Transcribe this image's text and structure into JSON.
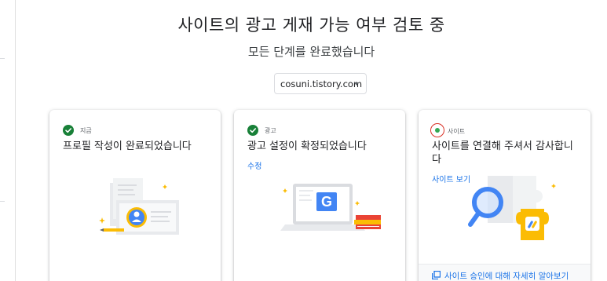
{
  "header": {
    "title": "사이트의 광고 게재 가능 여부 검토 중",
    "subtitle": "모든 단계를 완료했습니다"
  },
  "site_selector": {
    "value": "cosuni.tistory.com"
  },
  "cards": [
    {
      "step_label": "지금",
      "status": "complete",
      "heading": "프로필 작성이 완료되었습니다",
      "icon": "profile-card-illustration"
    },
    {
      "step_label": "광고",
      "status": "complete",
      "heading": "광고 설정이 확정되었습니다",
      "link": "수정",
      "icon": "laptop-google-illustration"
    },
    {
      "step_label": "사이트",
      "status": "pending",
      "heading": "사이트를 연결해 주셔서 감사합니다",
      "link": "사이트 보기",
      "footer_link": "사이트 승인에 대해 자세히 알아보기",
      "icon": "puzzle-search-illustration"
    }
  ],
  "colors": {
    "success": "#188038",
    "pending_ring": "#d93025",
    "pending_dot": "#34a853",
    "link": "#1a73e8",
    "google_blue": "#4285f4",
    "illustration_yellow": "#fbbc04"
  }
}
